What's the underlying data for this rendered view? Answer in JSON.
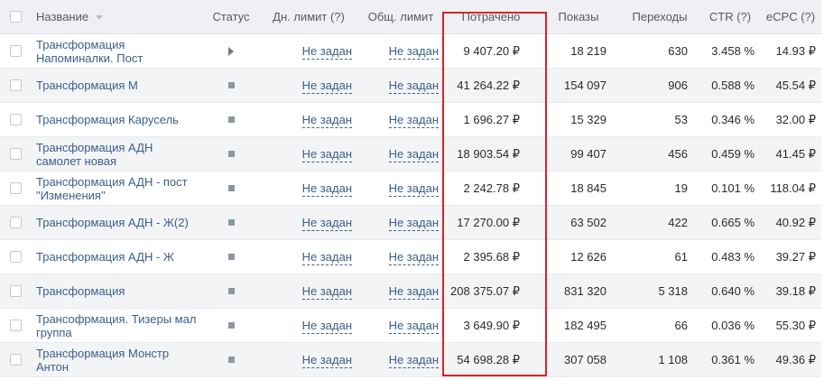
{
  "columns": {
    "name": "Название",
    "status": "Статус",
    "day_limit": "Дн. лимит (?)",
    "total_limit": "Общ. лимит",
    "spent": "Потрачено",
    "impressions": "Показы",
    "clicks": "Переходы",
    "ctr": "CTR (?)",
    "ecpc": "eCPC (?)"
  },
  "rows": [
    {
      "name": "Трансформация Напоминалки. Пост",
      "status": "play-icon",
      "day_limit": "Не задан",
      "total_limit": "Не задан",
      "spent": "9 407.20 ₽",
      "impressions": "18 219",
      "clicks": "630",
      "ctr": "3.458 %",
      "ecpc": "14.93 ₽"
    },
    {
      "name": "Трансформация М",
      "status": "stop-icon",
      "day_limit": "Не задан",
      "total_limit": "Не задан",
      "spent": "41 264.22 ₽",
      "impressions": "154 097",
      "clicks": "906",
      "ctr": "0.588 %",
      "ecpc": "45.54 ₽"
    },
    {
      "name": "Трансформация Карусель",
      "status": "stop-icon",
      "day_limit": "Не задан",
      "total_limit": "Не задан",
      "spent": "1 696.27 ₽",
      "impressions": "15 329",
      "clicks": "53",
      "ctr": "0.346 %",
      "ecpc": "32.00 ₽"
    },
    {
      "name": "Трансформация АДН самолет новая",
      "status": "stop-icon",
      "day_limit": "Не задан",
      "total_limit": "Не задан",
      "spent": "18 903.54 ₽",
      "impressions": "99 407",
      "clicks": "456",
      "ctr": "0.459 %",
      "ecpc": "41.45 ₽"
    },
    {
      "name": "Трансформация АДН - пост \"Изменения\"",
      "status": "stop-icon",
      "day_limit": "Не задан",
      "total_limit": "Не задан",
      "spent": "2 242.78 ₽",
      "impressions": "18 845",
      "clicks": "19",
      "ctr": "0.101 %",
      "ecpc": "118.04 ₽"
    },
    {
      "name": "Трансформация АДН - Ж(2)",
      "status": "stop-icon",
      "day_limit": "Не задан",
      "total_limit": "Не задан",
      "spent": "17 270.00 ₽",
      "impressions": "63 502",
      "clicks": "422",
      "ctr": "0.665 %",
      "ecpc": "40.92 ₽"
    },
    {
      "name": "Трансформация АДН - Ж",
      "status": "stop-icon",
      "day_limit": "Не задан",
      "total_limit": "Не задан",
      "spent": "2 395.68 ₽",
      "impressions": "12 626",
      "clicks": "61",
      "ctr": "0.483 %",
      "ecpc": "39.27 ₽"
    },
    {
      "name": "Трансформация",
      "status": "stop-icon",
      "day_limit": "Не задан",
      "total_limit": "Не задан",
      "spent": "208 375.07 ₽",
      "impressions": "831 320",
      "clicks": "5 318",
      "ctr": "0.640 %",
      "ecpc": "39.18 ₽"
    },
    {
      "name": "Трансофрмация. Тизеры мал группа",
      "status": "stop-icon",
      "day_limit": "Не задан",
      "total_limit": "Не задан",
      "spent": "3 649.90 ₽",
      "impressions": "182 495",
      "clicks": "66",
      "ctr": "0.036 %",
      "ecpc": "55.30 ₽"
    },
    {
      "name": "Трансформация Монстр Антон",
      "status": "stop-icon",
      "day_limit": "Не задан",
      "total_limit": "Не задан",
      "spent": "54 698.28 ₽",
      "impressions": "307 058",
      "clicks": "1 108",
      "ctr": "0.361 %",
      "ecpc": "49.36 ₽"
    }
  ],
  "colors": {
    "header_bg": "#eef0f3",
    "link": "#3a5f8a",
    "highlight_border": "#e0202a",
    "alt_row": "#f3f4f6"
  }
}
